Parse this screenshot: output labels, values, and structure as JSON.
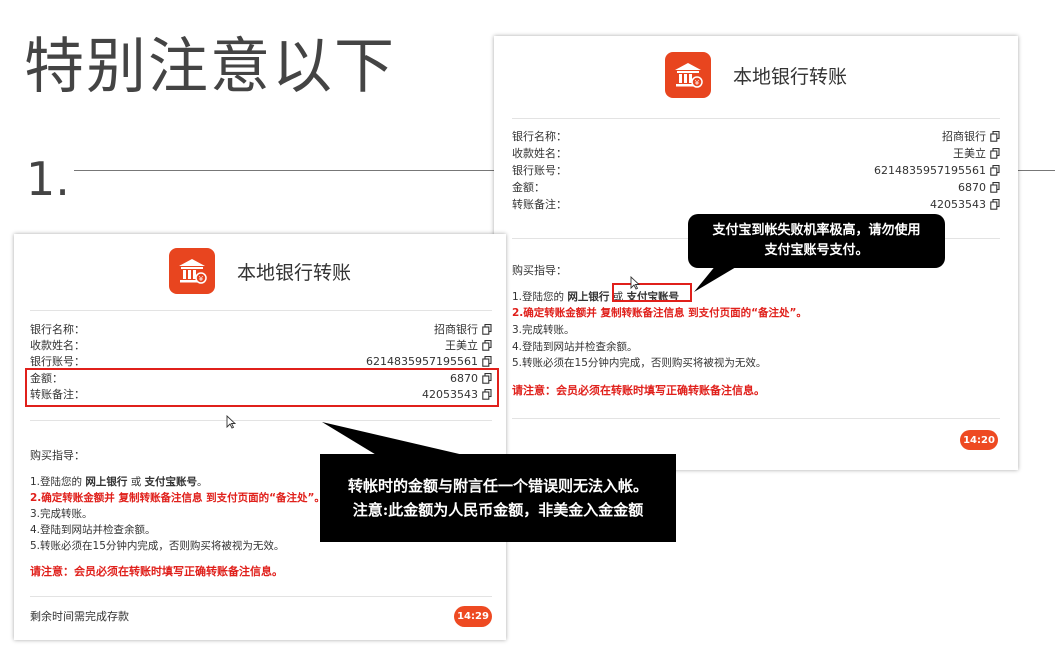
{
  "slide": {
    "title": "特别注意以下",
    "step_number": "1."
  },
  "card_front": {
    "title": "本地银行转账",
    "rows": [
      {
        "label": "银行名称：",
        "value": "招商银行"
      },
      {
        "label": "收款姓名：",
        "value": "王美立"
      },
      {
        "label": "银行账号：",
        "value": "6214835957195561"
      },
      {
        "label": "金额：",
        "value": "6870"
      },
      {
        "label": "转账备注：",
        "value": "42053543"
      }
    ],
    "guide_title": "购买指导：",
    "steps": [
      {
        "prefix": "1.登陆您的 ",
        "bold1": "网上银行",
        "mid": " 或 ",
        "bold2": "支付宝账号",
        "suffix": "。"
      },
      {
        "text": "2.确定转账金额并 复制转账备注信息 到支付页面的“备注处”。"
      },
      {
        "text": "3.完成转账。"
      },
      {
        "text": "4.登陆到网站并检查余额。"
      },
      {
        "text": "5.转账必须在15分钟内完成，否则购买将被视为无效。"
      }
    ],
    "notice": "请注意：会员必须在转账时填写正确转账备注信息。",
    "remaining_text": "剩余时间需完成存款",
    "timer": "14:29"
  },
  "card_back": {
    "title": "本地银行转账",
    "rows": [
      {
        "label": "银行名称：",
        "value": "招商银行"
      },
      {
        "label": "收款姓名：",
        "value": "王美立"
      },
      {
        "label": "银行账号：",
        "value": "6214835957195561"
      },
      {
        "label": "金额：",
        "value": "6870"
      },
      {
        "label": "转账备注：",
        "value": "42053543"
      }
    ],
    "guide_title": "购买指导：",
    "steps": [
      {
        "prefix": "1.登陆您的 ",
        "bold1": "网上银行",
        "mid": " 或 ",
        "bold2": "支付宝账号",
        "suffix": ""
      },
      {
        "text": "2.确定转账金额并 复制转账备注信息 到支付页面的“备注处”。"
      },
      {
        "text": "3.完成转账。"
      },
      {
        "text": "4.登陆到网站并检查余额。"
      },
      {
        "text": "5.转账必须在15分钟内完成，否则购买将被视为无效。"
      }
    ],
    "notice": "请注意：会员必须在转账时填写正确转账备注信息。",
    "timer": "14:20"
  },
  "callout_top": {
    "line1": "支付宝到帐失败机率极高，请勿使用",
    "line2": "支付宝账号支付。"
  },
  "callout_bottom": {
    "line1": "转帐时的金额与附言任一个错误则无法入帐。",
    "line2": "注意:此金额为人民币金额，非美金入金金额"
  },
  "colors": {
    "accent": "#e8451f",
    "highlight": "#e0201b",
    "callout_bg": "#000000"
  },
  "icons": {
    "logo": "bank-building-icon",
    "copy": "copy-icon",
    "cursor": "mouse-pointer-icon"
  }
}
